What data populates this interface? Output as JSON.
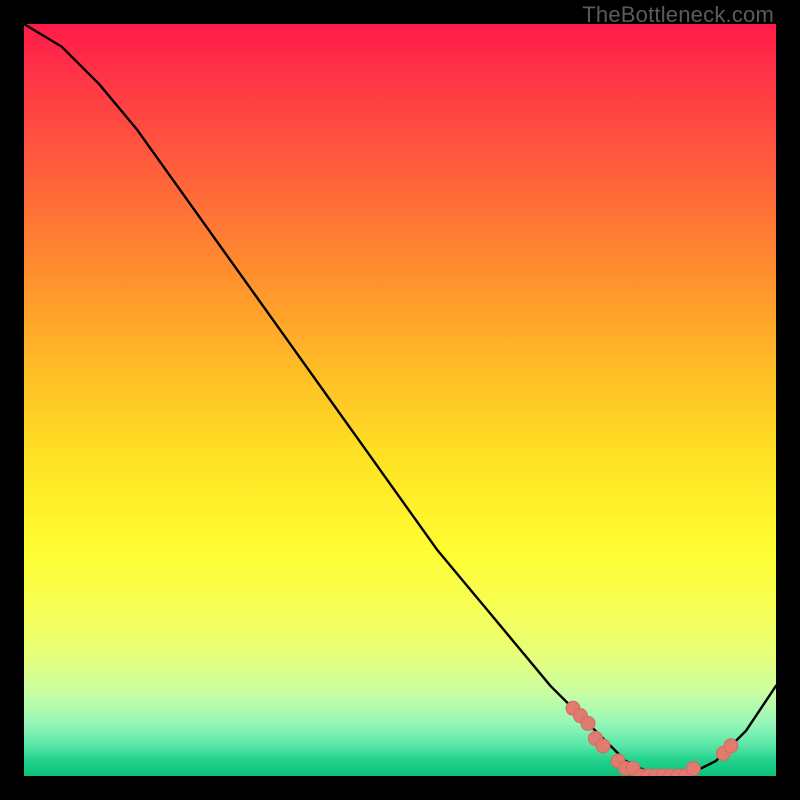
{
  "watermark": "TheBottleneck.com",
  "colors": {
    "frame": "#000000",
    "curve": "#000000",
    "marker_fill": "#e07b6f",
    "marker_stroke": "#d66a5e"
  },
  "chart_data": {
    "type": "line",
    "title": "",
    "xlabel": "",
    "ylabel": "",
    "xlim": [
      0,
      100
    ],
    "ylim": [
      0,
      100
    ],
    "grid": false,
    "legend": false,
    "curve_note": "Single black curve: steep descent from top-left, reaching minimum ~0 near x≈81–88, then rising at the right edge. Orange dot markers cluster along the flat minimum and the start of the rise.",
    "series": [
      {
        "name": "curve",
        "x": [
          0,
          5,
          10,
          15,
          20,
          25,
          30,
          35,
          40,
          45,
          50,
          55,
          60,
          65,
          70,
          75,
          78,
          80,
          82,
          84,
          86,
          88,
          90,
          92,
          94,
          96,
          98,
          100
        ],
        "values": [
          100,
          97,
          92,
          86,
          79,
          72,
          65,
          58,
          51,
          44,
          37,
          30,
          24,
          18,
          12,
          7,
          4,
          2,
          1,
          0,
          0,
          0,
          1,
          2,
          4,
          6,
          9,
          12
        ]
      }
    ],
    "markers": [
      {
        "x": 73,
        "y": 9
      },
      {
        "x": 74,
        "y": 8
      },
      {
        "x": 75,
        "y": 7
      },
      {
        "x": 76,
        "y": 5
      },
      {
        "x": 77,
        "y": 4
      },
      {
        "x": 79,
        "y": 2
      },
      {
        "x": 80,
        "y": 1
      },
      {
        "x": 81,
        "y": 1
      },
      {
        "x": 82,
        "y": 0
      },
      {
        "x": 83,
        "y": 0
      },
      {
        "x": 84,
        "y": 0
      },
      {
        "x": 85,
        "y": 0
      },
      {
        "x": 86,
        "y": 0
      },
      {
        "x": 87,
        "y": 0
      },
      {
        "x": 88,
        "y": 0
      },
      {
        "x": 89,
        "y": 1
      },
      {
        "x": 93,
        "y": 3
      },
      {
        "x": 94,
        "y": 4
      }
    ]
  }
}
